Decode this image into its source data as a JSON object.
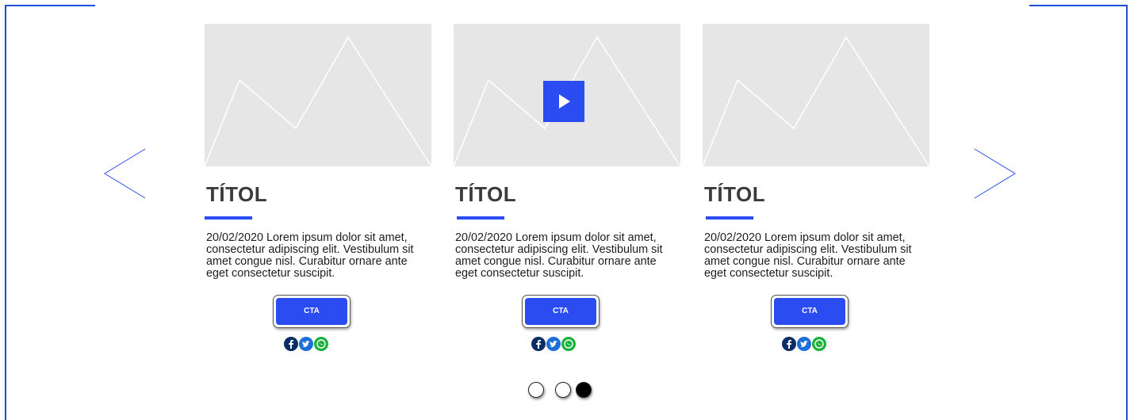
{
  "carousel": {
    "prev_icon": "chevron-left-icon",
    "next_icon": "chevron-right-icon",
    "accent_color": "#2a4cf0",
    "cards": [
      {
        "image_icon": "image-placeholder-icon",
        "has_video": false,
        "title": "TÍTOL",
        "description": "20/02/2020 Lorem ipsum dolor sit amet, consectetur adipiscing elit. Vestibulum sit amet congue nisl. Curabitur ornare ante eget consectetur suscipit.",
        "cta_label": "CTA",
        "social": [
          "facebook-icon",
          "twitter-icon",
          "whatsapp-icon"
        ]
      },
      {
        "image_icon": "image-placeholder-icon",
        "has_video": true,
        "title": "TÍTOL",
        "description": "20/02/2020 Lorem ipsum dolor sit amet, consectetur adipiscing elit. Vestibulum sit amet congue nisl. Curabitur ornare ante eget consectetur suscipit.",
        "cta_label": "CTA",
        "social": [
          "facebook-icon",
          "twitter-icon",
          "whatsapp-icon"
        ]
      },
      {
        "image_icon": "image-placeholder-icon",
        "has_video": false,
        "title": "TÍTOL",
        "description": "20/02/2020 Lorem ipsum dolor sit amet, consectetur adipiscing elit. Vestibulum sit amet congue nisl. Curabitur ornare ante eget consectetur suscipit.",
        "cta_label": "CTA",
        "social": [
          "facebook-icon",
          "twitter-icon",
          "whatsapp-icon"
        ]
      }
    ],
    "pagination": {
      "total": 3,
      "active": 3
    }
  }
}
